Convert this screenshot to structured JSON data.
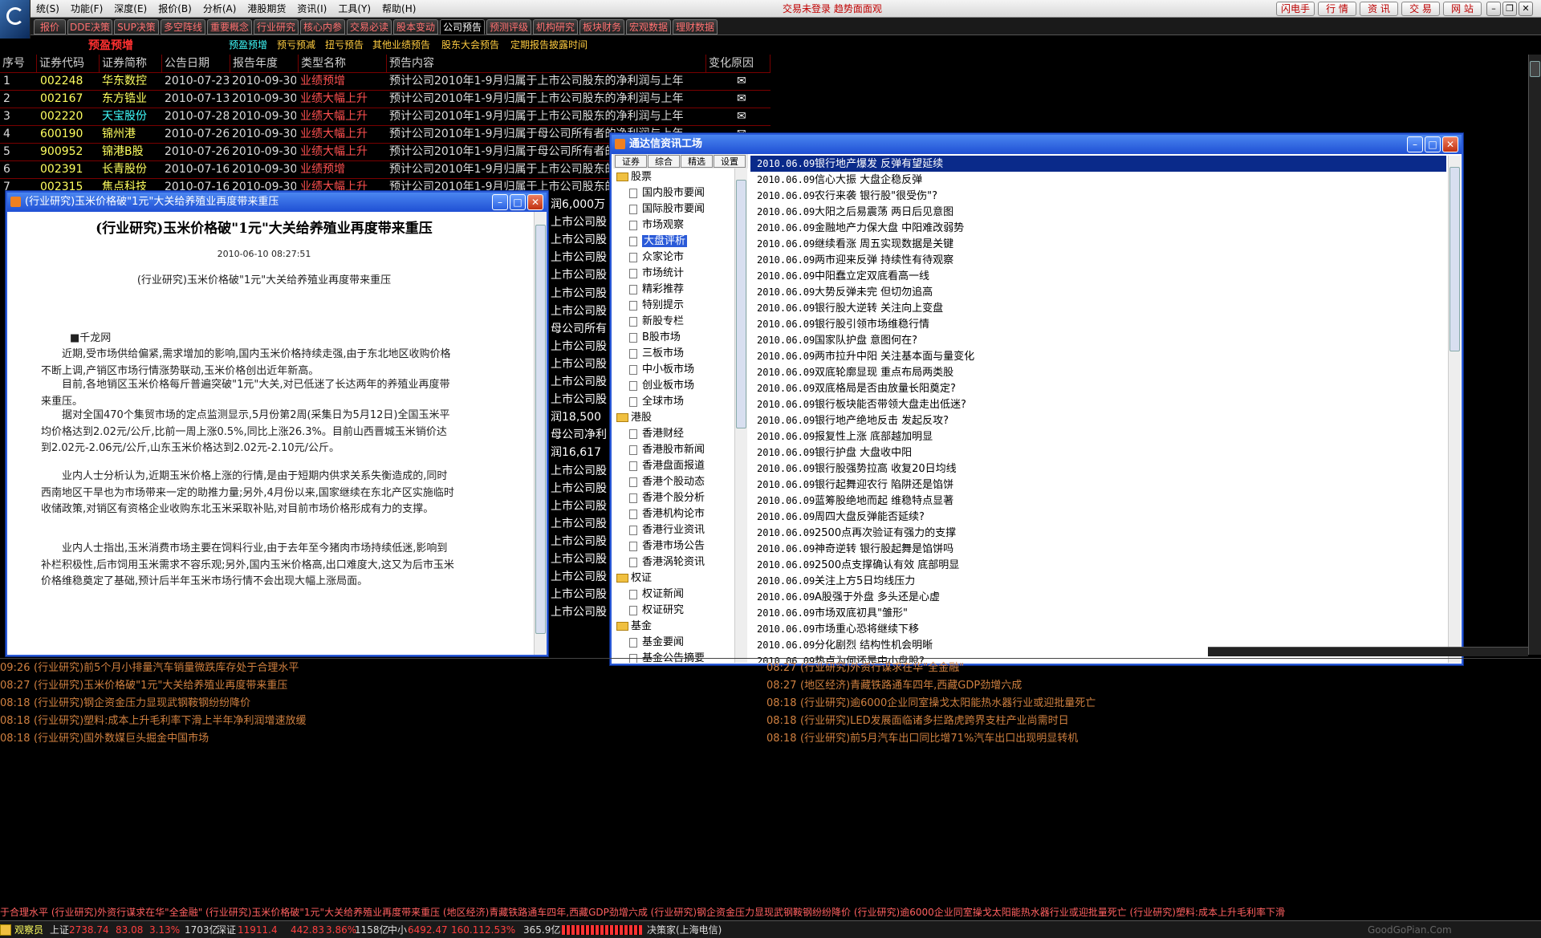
{
  "menu": {
    "items": [
      "统(S)",
      "功能(F)",
      "深度(E)",
      "报价(B)",
      "分析(A)",
      "港股期货",
      "资讯(I)",
      "工具(Y)",
      "帮助(H)"
    ],
    "notice": "交易未登录 趋势面面观",
    "right_buttons": [
      "闪电手",
      "行 情",
      "资 讯",
      "交 易",
      "网 站"
    ]
  },
  "tabs": [
    "报价",
    "DDE决策",
    "SUP决策",
    "多空阵线",
    "重要概念",
    "行业研究",
    "核心内参",
    "交易必读",
    "股本变动",
    "公司预告",
    "预测评级",
    "机构研究",
    "板块财务",
    "宏观数据",
    "理财数据"
  ],
  "subtabs": {
    "title": "预盈预增",
    "items": [
      "预盈预增",
      "预亏预减",
      "扭亏预告",
      "其他业绩预告",
      "股东大会预告",
      "定期报告披露时间"
    ]
  },
  "table": {
    "headers": [
      "序号",
      "证券代码",
      "证券简称",
      "公告日期",
      "报告年度",
      "类型名称",
      "预告内容",
      "变化原因"
    ],
    "rows": [
      {
        "no": "1",
        "code": "002248",
        "name": "华东数控",
        "ann": "2010-07-23",
        "rep": "2010-09-30",
        "type": "业绩预增",
        "content": "预计公司2010年1-9月归属于上市公司股东的净利润与上年"
      },
      {
        "no": "2",
        "code": "002167",
        "name": "东方锆业",
        "ann": "2010-07-13",
        "rep": "2010-09-30",
        "type": "业绩大幅上升",
        "content": "预计公司2010年1-9月归属于上市公司股东的净利润与上年"
      },
      {
        "no": "3",
        "code": "002220",
        "name": "天宝股份",
        "ann": "2010-07-28",
        "rep": "2010-09-30",
        "type": "业绩大幅上升",
        "content": "预计公司2010年1-9月归属于上市公司股东的净利润与上年"
      },
      {
        "no": "4",
        "code": "600190",
        "name": "锦州港",
        "ann": "2010-07-26",
        "rep": "2010-09-30",
        "type": "业绩大幅上升",
        "content": "预计公司2010年1-9月归属于母公司所有者的净利润与上年"
      },
      {
        "no": "5",
        "code": "900952",
        "name": "锦港B股",
        "ann": "2010-07-26",
        "rep": "2010-09-30",
        "type": "业绩大幅上升",
        "content": "预计公司2010年1-9月归属于母公司所有者的净利润与上年"
      },
      {
        "no": "6",
        "code": "002391",
        "name": "长青股份",
        "ann": "2010-07-16",
        "rep": "2010-09-30",
        "type": "业绩预增",
        "content": "预计公司2010年1-9月归属于上市公司股东的净利润与上年"
      },
      {
        "no": "7",
        "code": "002315",
        "name": "焦点科技",
        "ann": "2010-07-16",
        "rep": "2010-09-30",
        "type": "业绩大幅上升",
        "content": "预计公司2010年1-9月归属于上市公司股东的净利润与上年"
      }
    ],
    "right_fragments": [
      "润6,000万",
      "上市公司股",
      "上市公司股",
      "上市公司股",
      "上市公司股",
      "上市公司股",
      "上市公司股",
      "母公司所有",
      "上市公司股",
      "上市公司股",
      "上市公司股",
      "上市公司股",
      "润18,500",
      "母公司净利",
      "润16,617",
      "上市公司股",
      "上市公司股",
      "上市公司股",
      "上市公司股",
      "上市公司股",
      "上市公司股",
      "上市公司股",
      "上市公司股",
      "上市公司股"
    ]
  },
  "article": {
    "window_title": "(行业研究)玉米价格破\"1元\"大关给养殖业再度带来重压",
    "title": "(行业研究)玉米价格破\"1元\"大关给养殖业再度带来重压",
    "date": "2010-06-10 08:27:51",
    "subtitle": "(行业研究)玉米价格破\"1元\"大关给养殖业再度带来重压",
    "source": "■千龙网",
    "paras": [
      "近期,受市场供给偏紧,需求增加的影响,国内玉米价格持续走强,由于东北地区收购价格不断上调,产销区市场行情涨势联动,玉米价格创出近年新高。",
      "目前,各地销区玉米价格每斤普遍突破\"1元\"大关,对已低迷了长达两年的养殖业再度带来重压。",
      "据对全国470个集贸市场的定点监测显示,5月份第2周(采集日为5月12日)全国玉米平均价格达到2.02元/公斤,比前一周上涨0.5%,同比上涨26.3%。目前山西晋城玉米销价达到2.02元-2.06元/公斤,山东玉米价格达到2.02元-2.10元/公斤。",
      "业内人士分析认为,近期玉米价格上涨的行情,是由于短期内供求关系失衡造成的,同时西南地区干旱也为市场带来一定的助推力量;另外,4月份以来,国家继续在东北产区实施临时收储政策,对销区有资格企业收购东北玉米采取补贴,对目前市场价格形成有力的支撑。",
      "业内人士指出,玉米消费市场主要在饲料行业,由于去年至今猪肉市场持续低迷,影响到补栏积极性,后市饲用玉米需求不容乐观;另外,国内玉米价格高,出口难度大,这又为后市玉米价格维稳奠定了基础,预计后半年玉米市场行情不会出现大幅上涨局面。"
    ]
  },
  "info": {
    "window_title": "通达信资讯工场",
    "tabs": [
      "证券",
      "综合",
      "精选",
      "设置"
    ],
    "tree": [
      {
        "label": "股票",
        "folder": true
      },
      {
        "label": "国内股市要闻"
      },
      {
        "label": "国际股市要闻"
      },
      {
        "label": "市场观察"
      },
      {
        "label": "大盘评析",
        "sel": true
      },
      {
        "label": "众家论市"
      },
      {
        "label": "市场统计"
      },
      {
        "label": "精彩推荐"
      },
      {
        "label": "特别提示"
      },
      {
        "label": "新股专栏"
      },
      {
        "label": "B股市场"
      },
      {
        "label": "三板市场"
      },
      {
        "label": "中小板市场"
      },
      {
        "label": "创业板市场"
      },
      {
        "label": "全球市场"
      },
      {
        "label": "港股",
        "folder": true
      },
      {
        "label": "香港财经"
      },
      {
        "label": "香港股市新闻"
      },
      {
        "label": "香港盘面报道"
      },
      {
        "label": "香港个股动态"
      },
      {
        "label": "香港个股分析"
      },
      {
        "label": "香港机构论市"
      },
      {
        "label": "香港行业资讯"
      },
      {
        "label": "香港市场公告"
      },
      {
        "label": "香港涡轮资讯"
      },
      {
        "label": "权证",
        "folder": true
      },
      {
        "label": "权证新闻"
      },
      {
        "label": "权证研究"
      },
      {
        "label": "基金",
        "folder": true
      },
      {
        "label": "基金要闻"
      },
      {
        "label": "基金公告摘要"
      }
    ],
    "news": [
      {
        "d": "2010.06.09",
        "t": "银行地产爆发 反弹有望延续"
      },
      {
        "d": "2010.06.09",
        "t": "信心大振 大盘企稳反弹"
      },
      {
        "d": "2010.06.09",
        "t": "农行来袭 银行股\"很受伤\"?"
      },
      {
        "d": "2010.06.09",
        "t": "大阳之后易震荡 两日后见意图"
      },
      {
        "d": "2010.06.09",
        "t": "金融地产力保大盘 中阳难改弱势"
      },
      {
        "d": "2010.06.09",
        "t": "继续看涨 周五实现数据是关键"
      },
      {
        "d": "2010.06.09",
        "t": "两市迎来反弹 持续性有待观察"
      },
      {
        "d": "2010.06.09",
        "t": "中阳蠢立定双底看高一线"
      },
      {
        "d": "2010.06.09",
        "t": "大势反弹未完 但切勿追高"
      },
      {
        "d": "2010.06.09",
        "t": "银行股大逆转 关注向上变盘"
      },
      {
        "d": "2010.06.09",
        "t": "银行股引领市场维稳行情"
      },
      {
        "d": "2010.06.09",
        "t": "国家队护盘 意图何在?"
      },
      {
        "d": "2010.06.09",
        "t": "两市拉升中阳 关注基本面与量变化"
      },
      {
        "d": "2010.06.09",
        "t": "双底轮廓显现 重点布局两类股"
      },
      {
        "d": "2010.06.09",
        "t": "双底格局是否由放量长阳奠定?"
      },
      {
        "d": "2010.06.09",
        "t": "银行板块能否带领大盘走出低迷?"
      },
      {
        "d": "2010.06.09",
        "t": "银行地产绝地反击 发起反攻?"
      },
      {
        "d": "2010.06.09",
        "t": "报复性上涨 底部越加明显"
      },
      {
        "d": "2010.06.09",
        "t": "银行护盘 大盘收中阳"
      },
      {
        "d": "2010.06.09",
        "t": "银行股强势拉高 收复20日均线"
      },
      {
        "d": "2010.06.09",
        "t": "银行起舞迎农行 陷阱还是馅饼"
      },
      {
        "d": "2010.06.09",
        "t": "蓝筹股绝地而起 维稳特点显著"
      },
      {
        "d": "2010.06.09",
        "t": "周四大盘反弹能否延续?"
      },
      {
        "d": "2010.06.09",
        "t": "2500点再次验证有强力的支撑"
      },
      {
        "d": "2010.06.09",
        "t": "神奇逆转 银行股起舞是馅饼吗"
      },
      {
        "d": "2010.06.09",
        "t": "2500点支撑确认有效 底部明显"
      },
      {
        "d": "2010.06.09",
        "t": "关注上方5日均线压力"
      },
      {
        "d": "2010.06.09",
        "t": "A股强于外盘 多头还是心虚"
      },
      {
        "d": "2010.06.09",
        "t": "市场双底初具\"雏形\""
      },
      {
        "d": "2010.06.09",
        "t": "市场重心恐将继续下移"
      },
      {
        "d": "2010.06.09",
        "t": "分化剧烈 结构性机会明晰"
      },
      {
        "d": "2010.06.09",
        "t": "热点为何还是中小盘股?"
      }
    ]
  },
  "bottom_news": {
    "left": [
      {
        "t": "09:26",
        "x": "(行业研究)前5个月小排量汽车销量微跌库存处于合理水平"
      },
      {
        "t": "08:27",
        "x": "(行业研究)玉米价格破\"1元\"大关给养殖业再度带来重压"
      },
      {
        "t": "08:18",
        "x": "(行业研究)钢企资金压力显现武钢鞍钢纷纷降价"
      },
      {
        "t": "08:18",
        "x": "(行业研究)塑料:成本上升毛利率下滑上半年净利润增速放缓"
      },
      {
        "t": "08:18",
        "x": "(行业研究)国外数媒巨头掘金中国市场"
      }
    ],
    "right": [
      {
        "t": "08:27",
        "x": "(行业研究)外资行谋求在华\"全金融\""
      },
      {
        "t": "08:27",
        "x": "(地区经济)青藏铁路通车四年,西藏GDP劲增六成"
      },
      {
        "t": "08:18",
        "x": "(行业研究)逾6000企业同室操戈太阳能热水器行业或迎批量死亡"
      },
      {
        "t": "08:18",
        "x": "(行业研究)LED发展面临诸多拦路虎跨界支柱产业尚需时日"
      },
      {
        "t": "08:18",
        "x": "(行业研究)前5月汽车出口同比增71%汽车出口出现明显转机"
      }
    ]
  },
  "ticker": "于合理水平    (行业研究)外资行谋求在华\"全金融\"    (行业研究)玉米价格破\"1元\"大关给养殖业再度带来重压    (地区经济)青藏铁路通车四年,西藏GDP劲增六成    (行业研究)钢企资金压力显现武钢鞍钢纷纷降价    (行业研究)逾6000企业同室操戈太阳能热水器行业或迎批量死亡    (行业研究)塑料:成本上升毛利率下滑",
  "status": {
    "user": "观察员",
    "sh_label": "上证",
    "sh_val": "2738.74",
    "sh_chg": "83.08",
    "sh_pct": "3.13%",
    "sh_vol": "1703亿",
    "sz_label": "深证",
    "sz_val": "11911.4",
    "sz_chg": "442.83",
    "sz_pct": "3.86%",
    "sz_vol": "1158亿",
    "zx_label": "中小",
    "zx_val": "6492.47",
    "zx_chg": "160.11",
    "zx_pct": "2.53%",
    "zx_vol": "365.9亿",
    "server": "决策家(上海电信)",
    "watermark": "GoodGoPian.Com"
  }
}
